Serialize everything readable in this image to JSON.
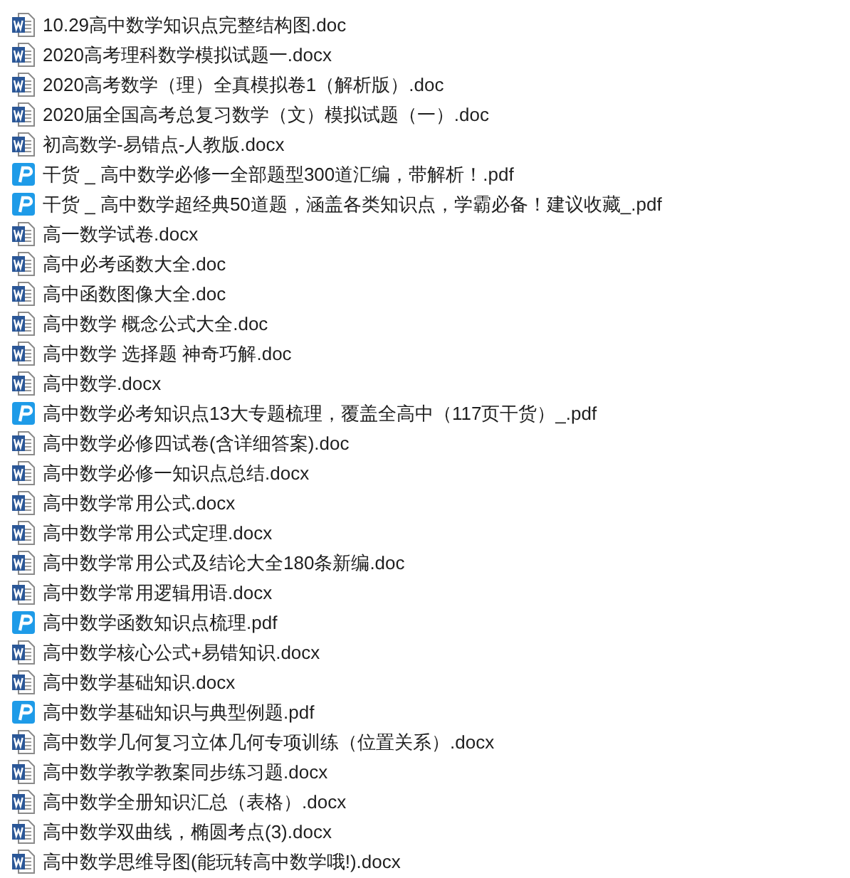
{
  "files": [
    {
      "name": "10.29高中数学知识点完整结构图.doc",
      "kind": "doc"
    },
    {
      "name": "2020高考理科数学模拟试题一.docx",
      "kind": "doc"
    },
    {
      "name": "2020高考数学（理）全真模拟卷1（解析版）.doc",
      "kind": "doc"
    },
    {
      "name": "2020届全国高考总复习数学（文）模拟试题（一）.doc",
      "kind": "doc"
    },
    {
      "name": "初高数学-易错点-人教版.docx",
      "kind": "doc"
    },
    {
      "name": "干货 _ 高中数学必修一全部题型300道汇编，带解析！.pdf",
      "kind": "pdf"
    },
    {
      "name": "干货 _ 高中数学超经典50道题，涵盖各类知识点，学霸必备！建议收藏_.pdf",
      "kind": "pdf"
    },
    {
      "name": "高一数学试卷.docx",
      "kind": "doc"
    },
    {
      "name": "高中必考函数大全.doc",
      "kind": "doc"
    },
    {
      "name": "高中函数图像大全.doc",
      "kind": "doc"
    },
    {
      "name": "高中数学 概念公式大全.doc",
      "kind": "doc"
    },
    {
      "name": "高中数学 选择题 神奇巧解.doc",
      "kind": "doc"
    },
    {
      "name": "高中数学.docx",
      "kind": "doc"
    },
    {
      "name": "高中数学必考知识点13大专题梳理，覆盖全高中（117页干货）_.pdf",
      "kind": "pdf"
    },
    {
      "name": "高中数学必修四试卷(含详细答案).doc",
      "kind": "doc"
    },
    {
      "name": "高中数学必修一知识点总结.docx",
      "kind": "doc"
    },
    {
      "name": "高中数学常用公式.docx",
      "kind": "doc"
    },
    {
      "name": "高中数学常用公式定理.docx",
      "kind": "doc"
    },
    {
      "name": "高中数学常用公式及结论大全180条新编.doc",
      "kind": "doc"
    },
    {
      "name": "高中数学常用逻辑用语.docx",
      "kind": "doc"
    },
    {
      "name": "高中数学函数知识点梳理.pdf",
      "kind": "pdf"
    },
    {
      "name": "高中数学核心公式+易错知识.docx",
      "kind": "doc"
    },
    {
      "name": "高中数学基础知识.docx",
      "kind": "doc"
    },
    {
      "name": "高中数学基础知识与典型例题.pdf",
      "kind": "pdf"
    },
    {
      "name": "高中数学几何复习立体几何专项训练（位置关系）.docx",
      "kind": "doc"
    },
    {
      "name": "高中数学教学教案同步练习题.docx",
      "kind": "doc"
    },
    {
      "name": "高中数学全册知识汇总（表格）.docx",
      "kind": "doc"
    },
    {
      "name": "高中数学双曲线，椭圆考点(3).docx",
      "kind": "doc"
    },
    {
      "name": "高中数学思维导图(能玩转高中数学哦!).docx",
      "kind": "doc"
    }
  ]
}
